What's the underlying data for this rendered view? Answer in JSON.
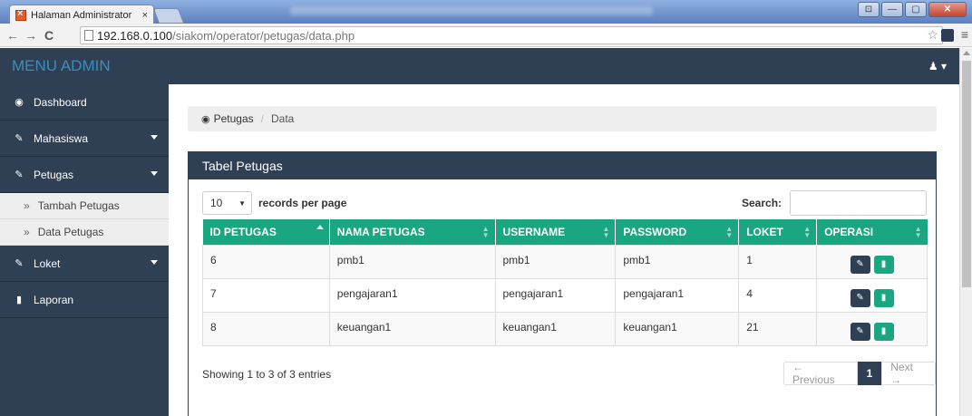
{
  "browser": {
    "tab_title": "Halaman Administrator",
    "tab_close": "×",
    "url_host": "192.168.0.100",
    "url_path": "/siakom/operator/petugas/data.php"
  },
  "navbar": {
    "brand": "MENU ADMIN",
    "user_menu": "▾"
  },
  "sidebar": {
    "items": [
      {
        "label": "Dashboard"
      },
      {
        "label": "Mahasiswa"
      },
      {
        "label": "Petugas"
      },
      {
        "label": "Loket"
      },
      {
        "label": "Laporan"
      }
    ],
    "sub_items": [
      {
        "label": "Tambah Petugas"
      },
      {
        "label": "Data Petugas"
      }
    ]
  },
  "breadcrumb": {
    "parent": "Petugas",
    "separator": "/",
    "current": "Data"
  },
  "panel": {
    "title": "Tabel Petugas",
    "length_value": "10",
    "length_label": "records per page",
    "search_label": "Search:",
    "search_value": "",
    "columns": [
      "ID PETUGAS",
      "NAMA PETUGAS",
      "USERNAME",
      "PASSWORD",
      "LOKET",
      "OPERASI"
    ],
    "rows": [
      {
        "id": "6",
        "nama": "pmb1",
        "username": "pmb1",
        "password": "pmb1",
        "loket": "1"
      },
      {
        "id": "7",
        "nama": "pengajaran1",
        "username": "pengajaran1",
        "password": "pengajaran1",
        "loket": "4"
      },
      {
        "id": "8",
        "nama": "keuangan1",
        "username": "keuangan1",
        "password": "keuangan1",
        "loket": "21"
      }
    ],
    "info": "Showing 1 to 3 of 3 entries",
    "pagination": {
      "prev": "← Previous",
      "current": "1",
      "next": "Next →"
    }
  },
  "colors": {
    "navy": "#2f4054",
    "teal": "#1aa680",
    "brand_blue": "#3c8dbc"
  }
}
